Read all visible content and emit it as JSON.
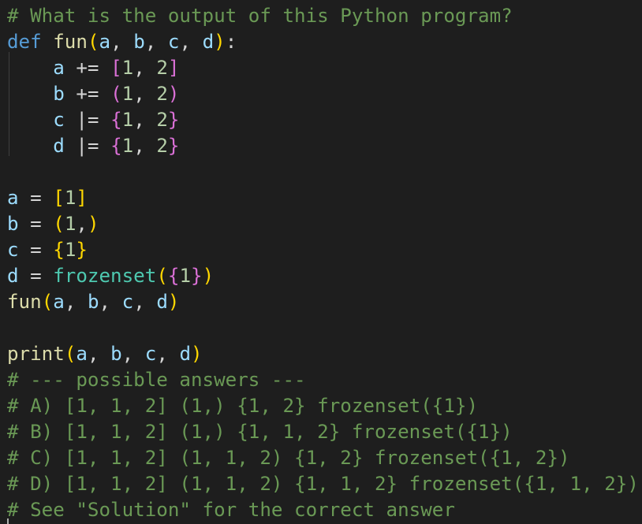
{
  "code": {
    "lines": [
      [
        {
          "t": "# What is the output of this Python program?",
          "c": "comment"
        }
      ],
      [
        {
          "t": "def",
          "c": "kw"
        },
        {
          "t": " ",
          "c": "op"
        },
        {
          "t": "fun",
          "c": "fn"
        },
        {
          "t": "(",
          "c": "b1"
        },
        {
          "t": "a",
          "c": "var"
        },
        {
          "t": ", ",
          "c": "punc"
        },
        {
          "t": "b",
          "c": "var"
        },
        {
          "t": ", ",
          "c": "punc"
        },
        {
          "t": "c",
          "c": "var"
        },
        {
          "t": ", ",
          "c": "punc"
        },
        {
          "t": "d",
          "c": "var"
        },
        {
          "t": ")",
          "c": "b1"
        },
        {
          "t": ":",
          "c": "punc"
        }
      ],
      [
        {
          "t": "    ",
          "c": "op"
        },
        {
          "t": "a",
          "c": "var"
        },
        {
          "t": " += ",
          "c": "op"
        },
        {
          "t": "[",
          "c": "b2"
        },
        {
          "t": "1",
          "c": "num"
        },
        {
          "t": ", ",
          "c": "punc"
        },
        {
          "t": "2",
          "c": "num"
        },
        {
          "t": "]",
          "c": "b2"
        }
      ],
      [
        {
          "t": "    ",
          "c": "op"
        },
        {
          "t": "b",
          "c": "var"
        },
        {
          "t": " += ",
          "c": "op"
        },
        {
          "t": "(",
          "c": "b2"
        },
        {
          "t": "1",
          "c": "num"
        },
        {
          "t": ", ",
          "c": "punc"
        },
        {
          "t": "2",
          "c": "num"
        },
        {
          "t": ")",
          "c": "b2"
        }
      ],
      [
        {
          "t": "    ",
          "c": "op"
        },
        {
          "t": "c",
          "c": "var"
        },
        {
          "t": " |= ",
          "c": "op"
        },
        {
          "t": "{",
          "c": "b2"
        },
        {
          "t": "1",
          "c": "num"
        },
        {
          "t": ", ",
          "c": "punc"
        },
        {
          "t": "2",
          "c": "num"
        },
        {
          "t": "}",
          "c": "b2"
        }
      ],
      [
        {
          "t": "    ",
          "c": "op"
        },
        {
          "t": "d",
          "c": "var"
        },
        {
          "t": " |= ",
          "c": "op"
        },
        {
          "t": "{",
          "c": "b2"
        },
        {
          "t": "1",
          "c": "num"
        },
        {
          "t": ", ",
          "c": "punc"
        },
        {
          "t": "2",
          "c": "num"
        },
        {
          "t": "}",
          "c": "b2"
        }
      ],
      [],
      [
        {
          "t": "a",
          "c": "var"
        },
        {
          "t": " = ",
          "c": "op"
        },
        {
          "t": "[",
          "c": "b1"
        },
        {
          "t": "1",
          "c": "num"
        },
        {
          "t": "]",
          "c": "b1"
        }
      ],
      [
        {
          "t": "b",
          "c": "var"
        },
        {
          "t": " = ",
          "c": "op"
        },
        {
          "t": "(",
          "c": "b1"
        },
        {
          "t": "1",
          "c": "num"
        },
        {
          "t": ",",
          "c": "punc"
        },
        {
          "t": ")",
          "c": "b1"
        }
      ],
      [
        {
          "t": "c",
          "c": "var"
        },
        {
          "t": " = ",
          "c": "op"
        },
        {
          "t": "{",
          "c": "b1"
        },
        {
          "t": "1",
          "c": "num"
        },
        {
          "t": "}",
          "c": "b1"
        }
      ],
      [
        {
          "t": "d",
          "c": "var"
        },
        {
          "t": " = ",
          "c": "op"
        },
        {
          "t": "frozenset",
          "c": "cls"
        },
        {
          "t": "(",
          "c": "b1"
        },
        {
          "t": "{",
          "c": "b2"
        },
        {
          "t": "1",
          "c": "num"
        },
        {
          "t": "}",
          "c": "b2"
        },
        {
          "t": ")",
          "c": "b1"
        }
      ],
      [
        {
          "t": "fun",
          "c": "fn"
        },
        {
          "t": "(",
          "c": "b1"
        },
        {
          "t": "a",
          "c": "var"
        },
        {
          "t": ", ",
          "c": "punc"
        },
        {
          "t": "b",
          "c": "var"
        },
        {
          "t": ", ",
          "c": "punc"
        },
        {
          "t": "c",
          "c": "var"
        },
        {
          "t": ", ",
          "c": "punc"
        },
        {
          "t": "d",
          "c": "var"
        },
        {
          "t": ")",
          "c": "b1"
        }
      ],
      [],
      [
        {
          "t": "print",
          "c": "fn"
        },
        {
          "t": "(",
          "c": "b1"
        },
        {
          "t": "a",
          "c": "var"
        },
        {
          "t": ", ",
          "c": "punc"
        },
        {
          "t": "b",
          "c": "var"
        },
        {
          "t": ", ",
          "c": "punc"
        },
        {
          "t": "c",
          "c": "var"
        },
        {
          "t": ", ",
          "c": "punc"
        },
        {
          "t": "d",
          "c": "var"
        },
        {
          "t": ")",
          "c": "b1"
        }
      ],
      [
        {
          "t": "# --- possible answers ---",
          "c": "comment"
        }
      ],
      [
        {
          "t": "# A) [1, 1, 2] (1,) {1, 2} frozenset({1})",
          "c": "comment"
        }
      ],
      [
        {
          "t": "# B) [1, 1, 2] (1,) {1, 1, 2} frozenset({1})",
          "c": "comment"
        }
      ],
      [
        {
          "t": "# C) [1, 1, 2] (1, 1, 2) {1, 2} frozenset({1, 2})",
          "c": "comment"
        }
      ],
      [
        {
          "t": "# D) [1, 1, 2] (1, 1, 2) {1, 1, 2} frozenset({1, 1, 2})",
          "c": "comment"
        }
      ],
      [
        {
          "t": "# See \"Solution\" for the correct answer",
          "c": "comment"
        }
      ]
    ]
  },
  "theme": {
    "background": "#1e1e1e",
    "comment": "#6a9955",
    "keyword": "#569cd6",
    "function": "#dcdcaa",
    "variable": "#9cdcfe",
    "number": "#b5cea8",
    "bracket_level1": "#ffd700",
    "bracket_level2": "#da70d6",
    "class": "#4ec9b0"
  }
}
